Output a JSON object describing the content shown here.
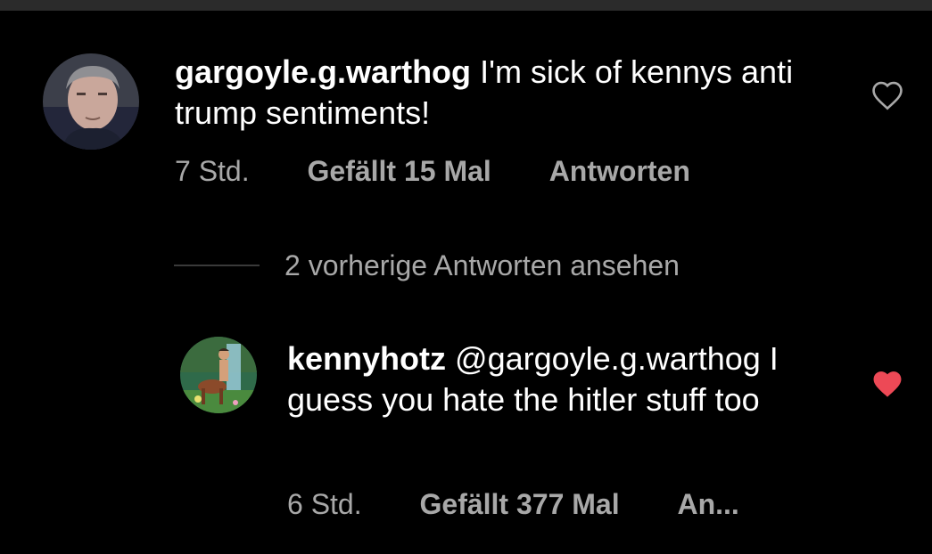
{
  "comment": {
    "username": "gargoyle.g.warthog",
    "text": "I'm sick of kennys anti trump sentiments!",
    "time": "7 Std.",
    "likes": "Gefällt 15 Mal",
    "reply_label": "Antworten",
    "liked": false,
    "avatar_icon": "profile-photo"
  },
  "view_replies_label": "2 vorherige Antworten ansehen",
  "reply": {
    "username": "kennyhotz",
    "mention": "@gargoyle.g.warthog",
    "text": "I guess you hate the hitler stuff too",
    "time": "6 Std.",
    "likes": "Gefällt 377 Mal",
    "reply_label": "An...",
    "liked": true,
    "avatar_icon": "profile-photo"
  },
  "colors": {
    "background": "#000000",
    "text": "#ffffff",
    "secondary_text": "#a8a8a8",
    "like_red": "#ed4956",
    "top_bar": "#2b2b2b"
  }
}
